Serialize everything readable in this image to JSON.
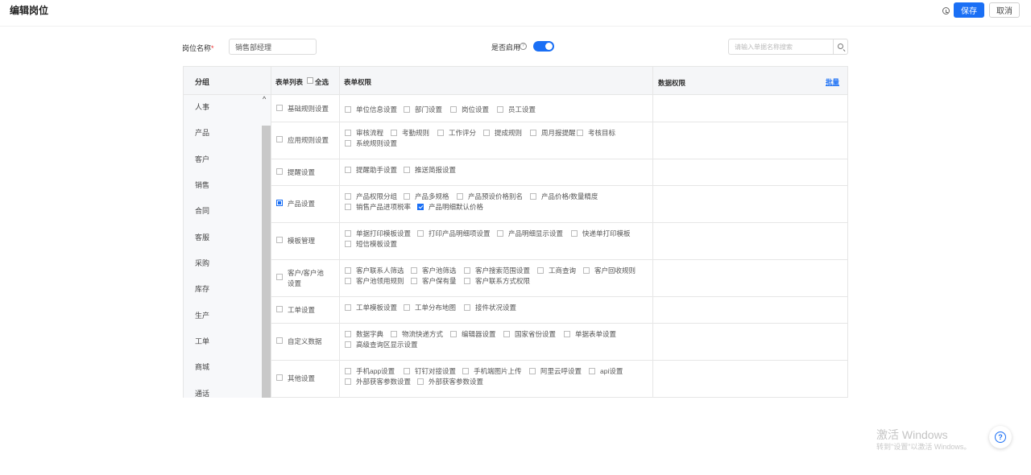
{
  "header": {
    "title": "编辑岗位",
    "save_label": "保存",
    "cancel_label": "取消"
  },
  "form": {
    "name_label": "岗位名称",
    "required_mark": "*",
    "name_value": "销售部经理",
    "enable_label": "是否启用",
    "enable_help": "?",
    "enabled": true,
    "search_placeholder": "请输入单据名称搜索"
  },
  "table": {
    "group_header": "分组",
    "form_list_header": "表单列表",
    "select_all_label": "全选",
    "form_perm_header": "表单权限",
    "data_perm_header": "数据权限",
    "batch_label": "批量"
  },
  "groups": [
    "人事",
    "产品",
    "客户",
    "销售",
    "合同",
    "客服",
    "采购",
    "库存",
    "生产",
    "工单",
    "商城",
    "通话"
  ],
  "rows": [
    {
      "name": "基础规则设置",
      "state": "unchecked",
      "perms": [
        {
          "label": "单位信息设置",
          "checked": false
        },
        {
          "label": "部门设置",
          "checked": false
        },
        {
          "label": "岗位设置",
          "checked": false
        },
        {
          "label": "员工设置",
          "checked": false
        }
      ]
    },
    {
      "name": "应用规则设置",
      "state": "unchecked",
      "perms": [
        {
          "label": "审核流程",
          "checked": false
        },
        {
          "label": "考勤规则",
          "checked": false
        },
        {
          "label": "工作评分",
          "checked": false
        },
        {
          "label": "提成规则",
          "checked": false
        },
        {
          "label": "周月报提醒",
          "checked": false
        },
        {
          "label": "考核目标",
          "checked": false
        },
        {
          "label": "系统规则设置",
          "checked": false
        }
      ]
    },
    {
      "name": "提醒设置",
      "state": "unchecked",
      "perms": [
        {
          "label": "提醒助手设置",
          "checked": false
        },
        {
          "label": "推送简报设置",
          "checked": false
        }
      ]
    },
    {
      "name": "产品设置",
      "state": "partial",
      "perms": [
        {
          "label": "产品权限分组",
          "checked": false
        },
        {
          "label": "产品多规格",
          "checked": false
        },
        {
          "label": "产品预设价格别名",
          "checked": false
        },
        {
          "label": "产品价格/数量精度",
          "checked": false
        },
        {
          "label": "销售产品进项税率",
          "checked": false
        },
        {
          "label": "产品明细默认价格",
          "checked": true
        }
      ]
    },
    {
      "name": "模板管理",
      "state": "unchecked",
      "perms": [
        {
          "label": "单据打印模板设置",
          "checked": false
        },
        {
          "label": "打印产品明细项设置",
          "checked": false
        },
        {
          "label": "产品明细显示设置",
          "checked": false
        },
        {
          "label": "快递单打印模板",
          "checked": false
        },
        {
          "label": "短信模板设置",
          "checked": false
        }
      ]
    },
    {
      "name": "客户/客户池设置",
      "name_line1": "客户/客户池",
      "name_line2": "设置",
      "state": "unchecked",
      "perms": [
        {
          "label": "客户联系人筛选",
          "checked": false
        },
        {
          "label": "客户池筛选",
          "checked": false
        },
        {
          "label": "客户搜索范围设置",
          "checked": false
        },
        {
          "label": "工商查询",
          "checked": false
        },
        {
          "label": "客户回收规则",
          "checked": false
        },
        {
          "label": "客户池领用规则",
          "checked": false
        },
        {
          "label": "客户保有量",
          "checked": false
        },
        {
          "label": "客户联系方式权限",
          "checked": false
        }
      ]
    },
    {
      "name": "工单设置",
      "state": "unchecked",
      "perms": [
        {
          "label": "工单模板设置",
          "checked": false
        },
        {
          "label": "工单分布地图",
          "checked": false
        },
        {
          "label": "接件状况设置",
          "checked": false
        }
      ]
    },
    {
      "name": "自定义数据",
      "state": "unchecked",
      "perms": [
        {
          "label": "数据字典",
          "checked": false
        },
        {
          "label": "物流快递方式",
          "checked": false
        },
        {
          "label": "编辑器设置",
          "checked": false
        },
        {
          "label": "国家省份设置",
          "checked": false
        },
        {
          "label": "单据表单设置",
          "checked": false
        },
        {
          "label": "高级查询区显示设置",
          "checked": false
        }
      ]
    },
    {
      "name": "其他设置",
      "state": "unchecked",
      "perms": [
        {
          "label": "手机app设置",
          "checked": false
        },
        {
          "label": "钉钉对接设置",
          "checked": false
        },
        {
          "label": "手机端图片上传",
          "checked": false
        },
        {
          "label": "阿里云呼设置",
          "checked": false
        },
        {
          "label": "api设置",
          "checked": false
        },
        {
          "label": "外部获客参数设置",
          "checked": false
        },
        {
          "label": "外部获客参数设置",
          "checked": false
        }
      ]
    }
  ],
  "watermark": {
    "line1": "激活 Windows",
    "line2": "转到\"设置\"以激活 Windows。"
  },
  "colors": {
    "accent": "#1a6ff5",
    "required": "#ee3333"
  }
}
